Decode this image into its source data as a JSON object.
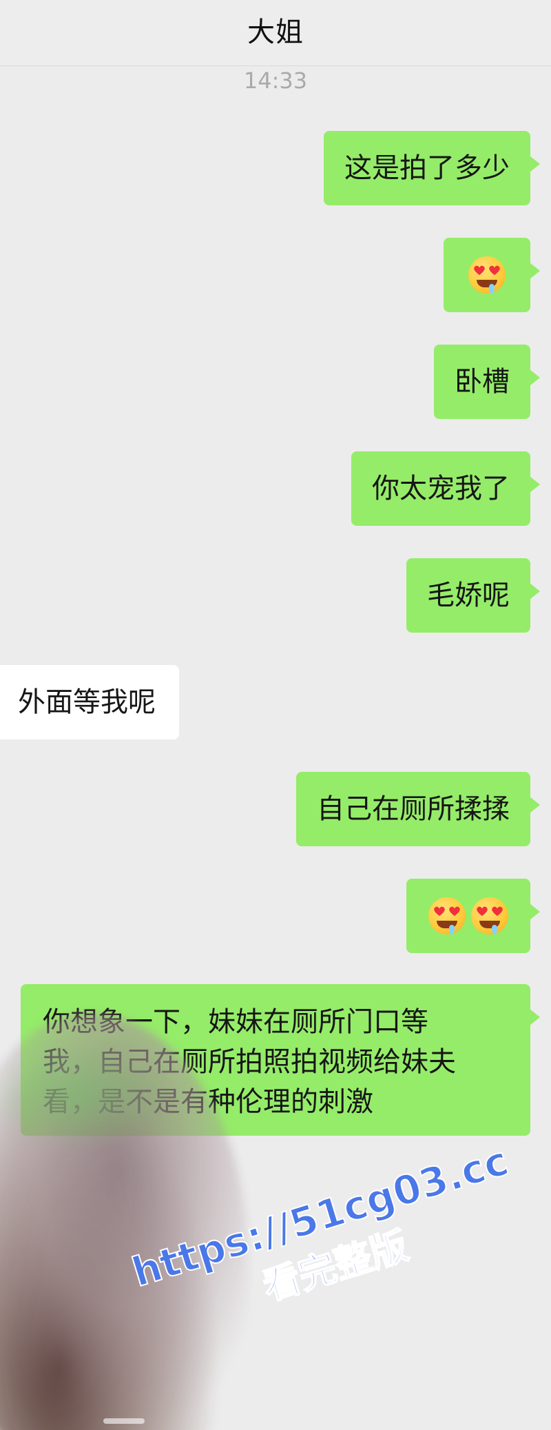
{
  "header": {
    "title": "大姐"
  },
  "timestamp": "14:33",
  "messages": [
    {
      "side": "sent",
      "text": "这是拍了多少"
    },
    {
      "side": "sent",
      "emoji": "heart-eyes-drooling-face"
    },
    {
      "side": "sent",
      "text": "卧槽"
    },
    {
      "side": "sent",
      "text": "你太宠我了"
    },
    {
      "side": "sent",
      "text": "毛娇呢"
    },
    {
      "side": "received",
      "text": "外面等我呢"
    },
    {
      "side": "sent",
      "text": "自己在厕所揉揉"
    },
    {
      "side": "sent",
      "emoji": "heart-eyes-drooling-face x2"
    },
    {
      "side": "sent",
      "lines": [
        "你想象一下，妹妹在厕所门口等",
        "我，自己在厕所拍照拍视频给妹夫",
        "看，是不是有种伦理的刺激"
      ]
    }
  ],
  "watermark": {
    "url": "https://51cg03.cc",
    "sub": "看完整版",
    "color": "#4a78e8"
  },
  "colors": {
    "sent_bubble": "#95ec69",
    "received_bubble": "#ffffff",
    "background": "#ececec"
  }
}
